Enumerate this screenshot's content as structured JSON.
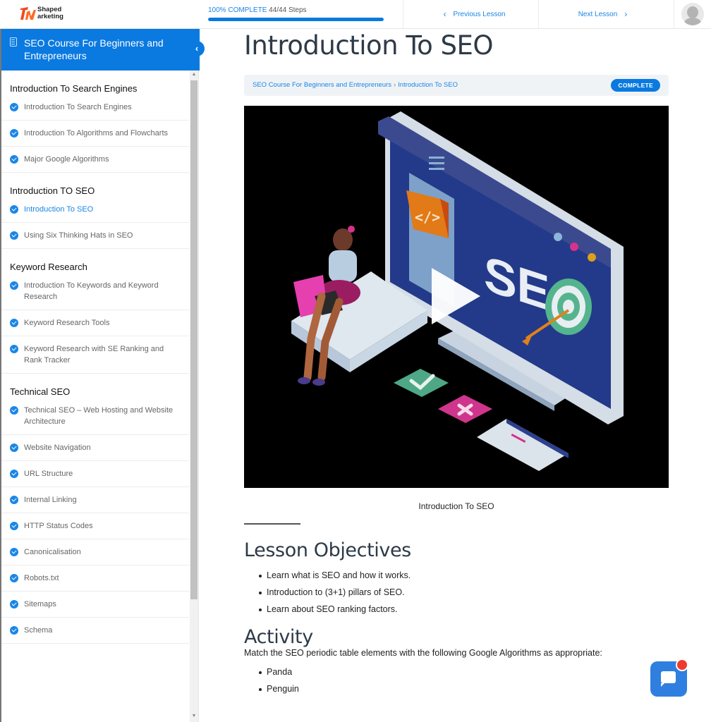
{
  "brand": {
    "name_line1": "Shaped",
    "name_line2": "arketing",
    "logo_colors": [
      "#f04a23",
      "#ff7a1a"
    ]
  },
  "colors": {
    "accent": "#0a7ae0",
    "link": "#1a86e6",
    "heading": "#2d3a48",
    "chat": "#2f7fe0",
    "notification": "#ef3b2d"
  },
  "topbar": {
    "progress_percent_label": "100% COMPLETE",
    "progress_steps": "44/44 Steps",
    "progress_value": 1.0,
    "previous_label": "Previous Lesson",
    "next_label": "Next Lesson",
    "avatar_icon": "user-avatar-icon"
  },
  "sidebar": {
    "course_title": "SEO Course For Beginners and Entrepreneurs",
    "sections": [
      {
        "title": "Introduction To Search Engines",
        "items": [
          {
            "label": "Introduction To Search Engines",
            "completed": true,
            "active": false
          },
          {
            "label": "Introduction To Algorithms and Flowcharts",
            "completed": true,
            "active": false
          },
          {
            "label": "Major Google Algorithms",
            "completed": true,
            "active": false
          }
        ]
      },
      {
        "title": "Introduction TO SEO",
        "items": [
          {
            "label": "Introduction To SEO",
            "completed": true,
            "active": true
          },
          {
            "label": "Using Six Thinking Hats in SEO",
            "completed": true,
            "active": false
          }
        ]
      },
      {
        "title": "Keyword Research",
        "items": [
          {
            "label": "Introduction To Keywords and Keyword Research",
            "completed": true,
            "active": false
          },
          {
            "label": "Keyword Research Tools",
            "completed": true,
            "active": false
          },
          {
            "label": "Keyword Research with SE Ranking and Rank Tracker",
            "completed": true,
            "active": false
          }
        ]
      },
      {
        "title": "Technical SEO",
        "items": [
          {
            "label": "Technical SEO – Web Hosting and Website Architecture",
            "completed": true,
            "active": false
          },
          {
            "label": "Website Navigation",
            "completed": true,
            "active": false
          },
          {
            "label": "URL Structure",
            "completed": true,
            "active": false
          },
          {
            "label": "Internal Linking",
            "completed": true,
            "active": false
          },
          {
            "label": "HTTP Status Codes",
            "completed": true,
            "active": false
          },
          {
            "label": "Canonicalisation",
            "completed": true,
            "active": false
          },
          {
            "label": "Robots.txt",
            "completed": true,
            "active": false
          },
          {
            "label": "Sitemaps",
            "completed": true,
            "active": false
          },
          {
            "label": "Schema",
            "completed": true,
            "active": false
          }
        ]
      }
    ]
  },
  "main": {
    "title": "Introduction To SEO",
    "breadcrumb": [
      "SEO Course For Beginners and Entrepreneurs",
      "Introduction To SEO"
    ],
    "breadcrumb_separator": "›",
    "status_badge": "COMPLETE",
    "video": {
      "illustration_text": "SEO",
      "code_glyph": "</>",
      "play_icon": "play-icon"
    },
    "video_caption": "Introduction To SEO",
    "objectives_title": "Lesson Objectives",
    "objectives": [
      "Learn what is SEO and how it works.",
      "Introduction to (3+1) pillars of SEO.",
      "Learn about SEO ranking factors."
    ],
    "activity_title": "Activity",
    "activity_text": "Match the SEO periodic table elements with the following Google Algorithms as appropriate:",
    "algorithms": [
      "Panda",
      "Penguin"
    ]
  },
  "chat_widget": {
    "icon": "chat-bubble-icon",
    "has_notification": true
  }
}
